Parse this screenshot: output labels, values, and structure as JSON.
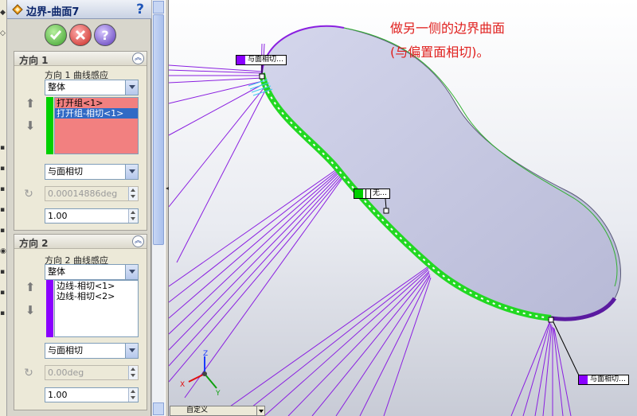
{
  "feature": {
    "title": "边界-曲面7",
    "help_glyph": "?"
  },
  "buttons": {
    "ok": "ok-icon",
    "cancel": "cancel-icon",
    "help": "?"
  },
  "direction1": {
    "header": "方向 1",
    "influence_label": "方向 1 曲线感应",
    "influence_value": "整体",
    "curves": [
      "打开组<1>",
      "打开组-相切<1>"
    ],
    "tangency_type": "与面相切",
    "draft_angle": "0.00014886deg",
    "tangent_influence": "1.00",
    "color": "#00d000"
  },
  "direction2": {
    "header": "方向 2",
    "influence_label": "方向 2 曲线感应",
    "influence_value": "整体",
    "curves": [
      "边线-相切<1>",
      "边线-相切<2>"
    ],
    "tangency_type": "与面相切",
    "draft_angle": "0.00deg",
    "tangent_influence": "1.00",
    "color": "#8a00ff"
  },
  "annotation": {
    "line1": "做另一侧的边界曲面",
    "line2": "(与偏置面相切)。"
  },
  "tags": {
    "top": "与面相切…",
    "middle": "无…",
    "bottom": "与面相切…"
  },
  "triad": {
    "x": "X",
    "y": "Y",
    "z": "Z"
  },
  "view_menu": {
    "value": "自定义"
  },
  "colors": {
    "surface": "#c4c6e2",
    "green_curve": "#22d822",
    "purple_curve": "#8a1fe0",
    "annotation": "#e0201e"
  }
}
